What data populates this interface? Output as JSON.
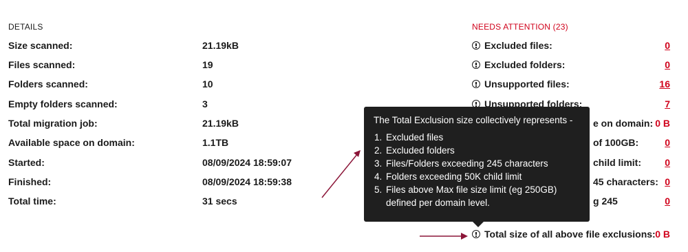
{
  "details": {
    "title": "DETAILS",
    "rows": [
      {
        "label": "Size scanned:",
        "value": "21.19kB"
      },
      {
        "label": "Files scanned:",
        "value": "19"
      },
      {
        "label": "Folders scanned:",
        "value": "10"
      },
      {
        "label": "Empty folders scanned:",
        "value": "3"
      },
      {
        "label": "Total migration job:",
        "value": "21.19kB"
      },
      {
        "label": "Available space on domain:",
        "value": "1.1TB"
      },
      {
        "label": "Started:",
        "value": "08/09/2024 18:59:07"
      },
      {
        "label": "Finished:",
        "value": "08/09/2024 18:59:38"
      },
      {
        "label": "Total time:",
        "value": "31 secs"
      }
    ]
  },
  "needs_attention": {
    "title": "NEEDS ATTENTION (23)",
    "rows": [
      {
        "label": "Excluded files:",
        "value": "0"
      },
      {
        "label": "Excluded folders:",
        "value": "0"
      },
      {
        "label": "Unsupported files:",
        "value": "16"
      },
      {
        "label": "Unsupported folders:",
        "value": "7"
      },
      {
        "label": "e on domain:",
        "value": "0 B"
      },
      {
        "label": "of 100GB:",
        "value": "0"
      },
      {
        "label": "child limit:",
        "value": "0"
      },
      {
        "label": "45 characters:",
        "value": "0"
      },
      {
        "label": "g 245",
        "value": "0"
      },
      {
        "label": "Total size of all above file exclusions:",
        "value": "0 B"
      }
    ]
  },
  "tooltip": {
    "heading": "The Total Exclusion size collectively represents -",
    "items": [
      "Excluded files",
      "Excluded folders",
      "Files/Folders exceeding 245 characters",
      "Folders exceeding 50K child limit",
      "Files above Max file size limit (eg 250GB) defined per domain level."
    ]
  },
  "colors": {
    "accent": "#d0021b",
    "annotation_arrow": "#8b1538",
    "tooltip_bg": "#1f1f1f"
  },
  "icons": {
    "row_icon": "alert-circle-icon"
  }
}
